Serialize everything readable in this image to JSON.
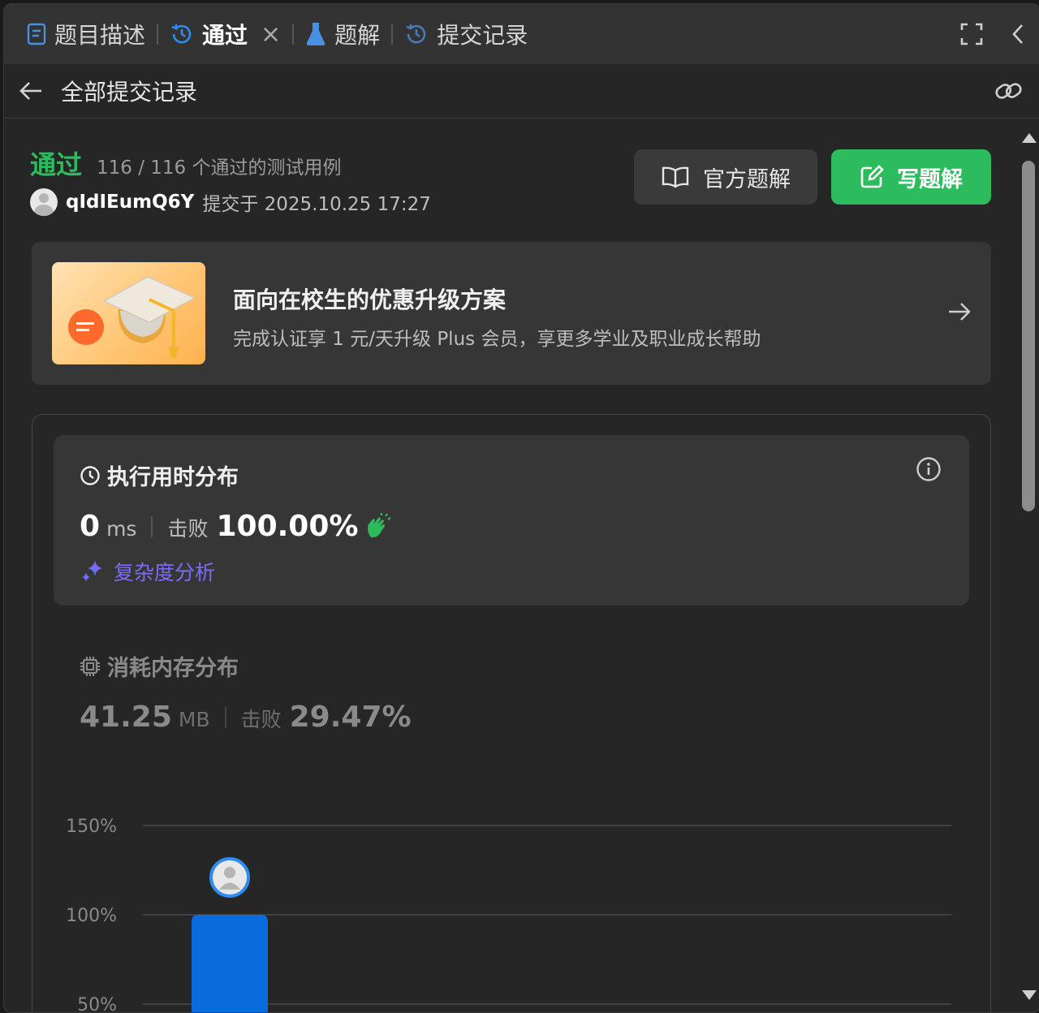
{
  "tabs": [
    {
      "label": "题目描述",
      "icon": "document-icon"
    },
    {
      "label": "通过",
      "icon": "history-icon",
      "active": true,
      "closable": true
    },
    {
      "label": "题解",
      "icon": "flask-icon"
    },
    {
      "label": "提交记录",
      "icon": "history-icon"
    }
  ],
  "subheader": {
    "title": "全部提交记录"
  },
  "submission": {
    "status": "通过",
    "testcases": "116 / 116 个通过的测试用例",
    "username": "qIdIEumQ6Y",
    "submitted_at": "提交于 2025.10.25 17:27"
  },
  "buttons": {
    "official": "官方题解",
    "write": "写题解"
  },
  "promo": {
    "title": "面向在校生的优惠升级方案",
    "subtitle": "完成认证享 1 元/天升级 Plus 会员，享更多学业及职业成长帮助"
  },
  "runtime": {
    "title": "执行用时分布",
    "value": "0",
    "unit": "ms",
    "beat_label": "击败",
    "beat_value": "100.00%",
    "complexity": "复杂度分析"
  },
  "memory": {
    "title": "消耗内存分布",
    "value": "41.25",
    "unit": "MB",
    "beat_label": "击败",
    "beat_value": "29.47%"
  },
  "chart_data": {
    "type": "bar",
    "title": "",
    "ytick_labels": [
      "150%",
      "100%",
      "50%"
    ],
    "series": [
      {
        "values": [
          100
        ]
      }
    ],
    "ylim": [
      50,
      150
    ],
    "bar_color": "#0a6bdd"
  },
  "colors": {
    "accent_green": "#2cbb5d",
    "accent_blue": "#0a6bdd",
    "accent_purple": "#7b6cf6"
  }
}
